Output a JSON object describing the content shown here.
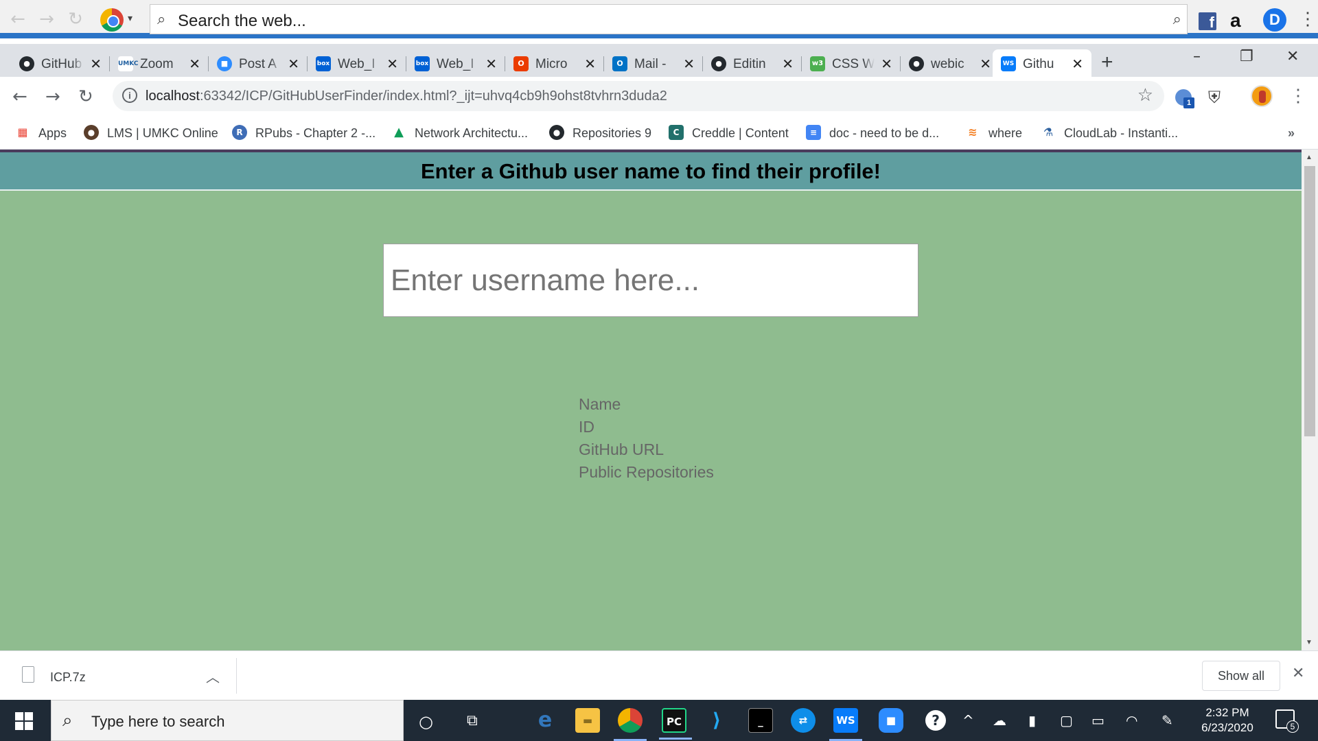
{
  "search_toolbar": {
    "placeholder": "Search the web..."
  },
  "tabs": [
    {
      "label": "GitHub",
      "icon": "github-icon"
    },
    {
      "label": "Zoom",
      "icon": "umkc-zoom-icon"
    },
    {
      "label": "Post A",
      "icon": "zoom-video-icon"
    },
    {
      "label": "Web_I",
      "icon": "box-icon"
    },
    {
      "label": "Web_I",
      "icon": "box-icon"
    },
    {
      "label": "Micro",
      "icon": "office-icon"
    },
    {
      "label": "Mail -",
      "icon": "outlook-icon"
    },
    {
      "label": "Editin",
      "icon": "github-icon"
    },
    {
      "label": "CSS W",
      "icon": "w3schools-icon"
    },
    {
      "label": "webic",
      "icon": "github-icon"
    },
    {
      "label": "Githu",
      "icon": "webstorm-icon",
      "active": true
    }
  ],
  "address": {
    "host": "localhost",
    "rest": ":63342/ICP/GitHubUserFinder/index.html?_ijt=uhvq4cb9h9ohst8tvhrn3duda2",
    "ext_badge": "1"
  },
  "bookmarks": [
    {
      "label": "Apps",
      "icon": "apps-grid-icon"
    },
    {
      "label": "LMS | UMKC Online",
      "icon": "umkc-icon"
    },
    {
      "label": "RPubs - Chapter 2 -...",
      "icon": "rpubs-icon"
    },
    {
      "label": "Network Architectu...",
      "icon": "google-drive-icon"
    },
    {
      "label": "Repositories 9",
      "icon": "github-icon"
    },
    {
      "label": "Creddle | Content",
      "icon": "creddle-icon"
    },
    {
      "label": "doc - need to be d...",
      "icon": "google-docs-icon"
    },
    {
      "label": "where",
      "icon": "stackoverflow-icon"
    },
    {
      "label": "CloudLab - Instanti...",
      "icon": "cloudlab-icon"
    }
  ],
  "page": {
    "heading": "Enter a Github user name to find their profile!",
    "input_placeholder": "Enter username here...",
    "fields": [
      "Name",
      "ID",
      "GitHub URL",
      "Public Repositories"
    ]
  },
  "downloads": {
    "file_name": "ICP.7z",
    "show_all": "Show all"
  },
  "taskbar": {
    "search_placeholder": "Type here to search",
    "time": "2:32 PM",
    "date": "6/23/2020",
    "notification_count": "5"
  },
  "colors": {
    "header_bg": "#5f9ea0",
    "page_bg": "#8fbc8f",
    "accent": "#2b74c7"
  }
}
